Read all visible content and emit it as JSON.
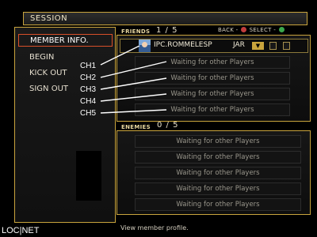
{
  "header": {
    "title": "SESSION"
  },
  "menu": {
    "items": [
      {
        "label": "MEMBER INFO."
      },
      {
        "label": "BEGIN"
      },
      {
        "label": "KICK OUT"
      },
      {
        "label": "SIGN OUT"
      }
    ]
  },
  "friends": {
    "label": "FRIENDS",
    "count": "1 / 5",
    "back_label": "BACK -",
    "select_label": "SELECT -",
    "player": {
      "name": "IPC.ROMMELESP",
      "tag": "JAR",
      "button": "▼"
    },
    "slots": [
      {
        "text": "Waiting for other Players"
      },
      {
        "text": "Waiting for other Players"
      },
      {
        "text": "Waiting for other Players"
      },
      {
        "text": "Waiting for other Players"
      }
    ]
  },
  "enemies": {
    "label": "ENEMIES",
    "count": "0 / 5",
    "slots": [
      {
        "text": "Waiting for other Players"
      },
      {
        "text": "Waiting for other Players"
      },
      {
        "text": "Waiting for other Players"
      },
      {
        "text": "Waiting for other Players"
      },
      {
        "text": "Waiting for other Players"
      }
    ]
  },
  "annotations": {
    "ch1": "CH1",
    "ch2": "CH2",
    "ch3": "CH3",
    "ch4": "CH4",
    "ch5": "CH5"
  },
  "status": {
    "text": "View member profile."
  },
  "watermark": {
    "text": "LOC|NET"
  }
}
